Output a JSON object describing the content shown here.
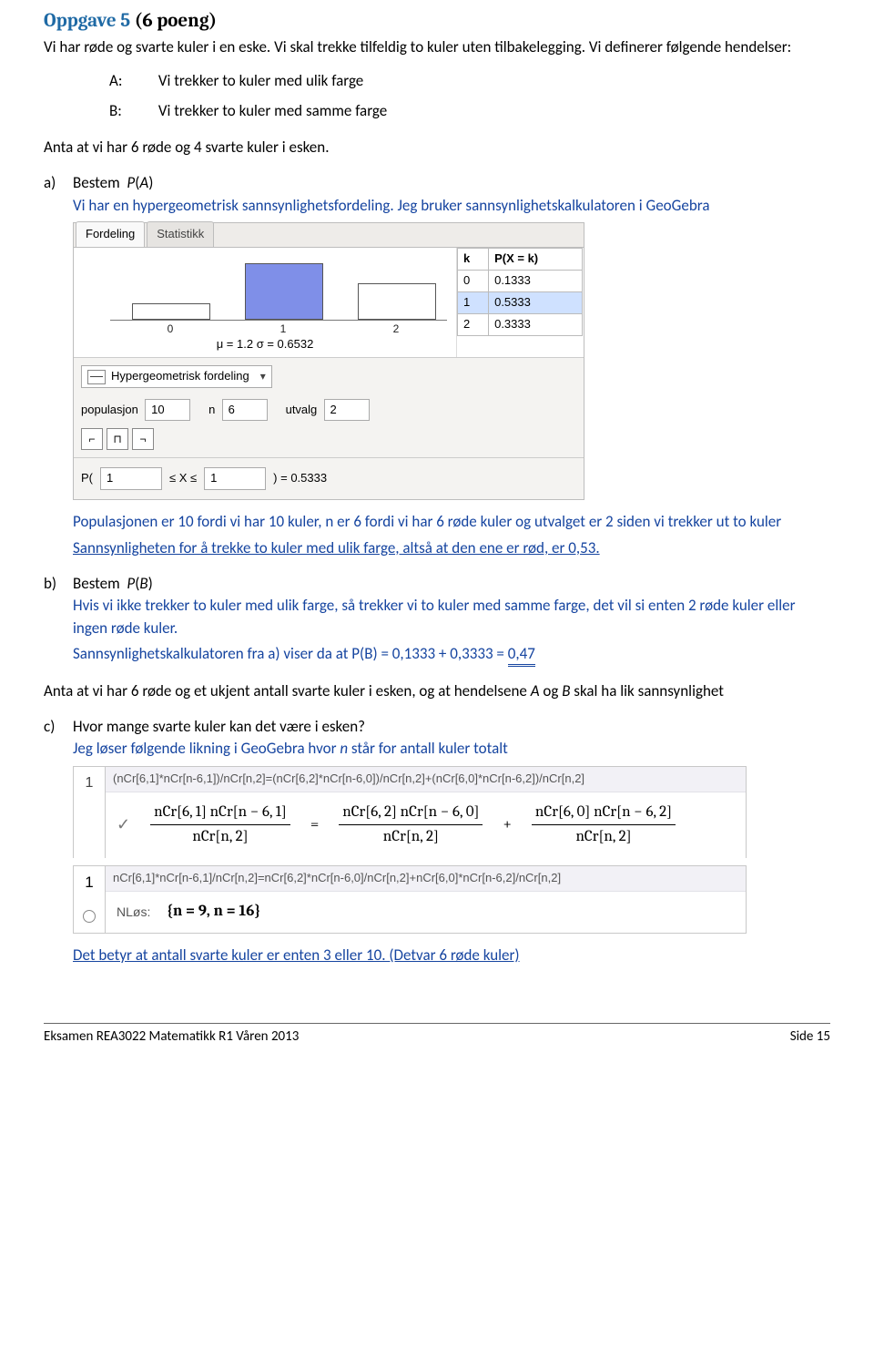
{
  "title": {
    "label": "Oppgave 5",
    "points": "(6 poeng)"
  },
  "intro": "Vi har røde og svarte kuler i en eske. Vi skal trekke tilfeldig to kuler uten tilbakelegging. Vi definerer følgende hendelser:",
  "events": {
    "A": {
      "label": "A:",
      "text": "Vi trekker to kuler med ulik farge"
    },
    "B": {
      "label": "B:",
      "text": "Vi trekker to kuler med samme farge"
    }
  },
  "assume1": "Anta at vi har 6 røde og 4 svarte kuler i esken.",
  "a": {
    "marker": "a)",
    "task": "Bestem  P(A)",
    "ans1": "Vi har en hypergeometrisk sannsynlighetsfordeling. Jeg bruker sannsynlighetskalkulatoren i GeoGebra",
    "pop": "Populasjonen er 10 fordi vi har 10 kuler, n er 6 fordi vi har 6 røde kuler og utvalget er 2 siden vi trekker ut to kuler",
    "concl": "Sannsynligheten for å trekke to kuler med ulik farge, altså at den ene er rød, er 0,53."
  },
  "b": {
    "marker": "b)",
    "task": "Bestem  P(B)",
    "ans1": "Hvis vi ikke trekker to kuler med ulik farge, så trekker vi to kuler med samme farge, det vil si enten 2 røde kuler eller ingen røde kuler.",
    "ans2_pre": "Sannsynlighetskalkulatoren fra a) viser da at ",
    "ans2_expr": "P(B) = 0,1333 + 0,3333 = ",
    "ans2_val": "0,47"
  },
  "assume2": "Anta at vi har 6 røde og et ukjent antall svarte kuler i esken, og at hendelsene A og B skal ha lik sannsynlighet",
  "c": {
    "marker": "c)",
    "task": "Hvor mange svarte kuler kan det være i esken?",
    "ans1": "Jeg løser følgende likning i GeoGebra hvor n står for antall kuler totalt",
    "concl": "Det betyr at antall svarte kuler er enten 3 eller 10. (Detvar 6 røde kuler)"
  },
  "gg": {
    "tabs": {
      "t1": "Fordeling",
      "t2": "Statistikk"
    },
    "ticks": [
      "0",
      "1",
      "2"
    ],
    "mu_sigma": "μ = 1.2   σ = 0.6532",
    "table": {
      "h1": "k",
      "h2": "P(X = k)",
      "rows": [
        {
          "k": "0",
          "p": "0.1333"
        },
        {
          "k": "1",
          "p": "0.5333"
        },
        {
          "k": "2",
          "p": "0.3333"
        }
      ]
    },
    "dist_label": "Hypergeometrisk fordeling",
    "params": {
      "pop_l": "populasjon",
      "pop_v": "10",
      "n_l": "n",
      "n_v": "6",
      "u_l": "utvalg",
      "u_v": "2"
    },
    "prob": {
      "pre": "P(",
      "a": "1",
      "mid": "≤  X  ≤",
      "b": "1",
      "post": ") = 0.5333"
    }
  },
  "cas": {
    "input1": "(nCr[6,1]*nCr[n-6,1])/nCr[n,2]=(nCr[6,2]*nCr[n-6,0])/nCr[n,2]+(nCr[6,0]*nCr[n-6,2])/nCr[n,2]",
    "row1_num": "1",
    "frac1_top": "nCr[6, 1]  nCr[n − 6, 1]",
    "frac1_bot": "nCr[n, 2]",
    "frac2_top": "nCr[6, 2]  nCr[n − 6, 0]",
    "frac2_bot": "nCr[n, 2]",
    "frac3_top": "nCr[6, 0]  nCr[n − 6, 2]",
    "frac3_bot": "nCr[n, 2]",
    "input2": "nCr[6,1]*nCr[n-6,1]/nCr[n,2]=nCr[6,2]*nCr[n-6,0]/nCr[n,2]+nCr[6,0]*nCr[n-6,2]/nCr[n,2]",
    "row2_num": "1",
    "solve_label": "NLøs:",
    "solve_result": "{n = 9, n = 16}"
  },
  "chart_data": {
    "type": "bar",
    "categories": [
      "0",
      "1",
      "2"
    ],
    "values": [
      0.1333,
      0.5333,
      0.3333
    ],
    "title": "Hypergeometrisk fordeling",
    "xlabel": "k",
    "ylabel": "P(X=k)",
    "ylim": [
      0,
      0.6
    ],
    "params": {
      "populasjon": 10,
      "n": 6,
      "utvalg": 2
    },
    "stats": {
      "mu": 1.2,
      "sigma": 0.6532
    },
    "interval": {
      "a": 1,
      "b": 1,
      "p": 0.5333
    }
  },
  "footer": {
    "left": "Eksamen REA3022 Matematikk R1 Våren 2013",
    "right": "Side 15"
  }
}
